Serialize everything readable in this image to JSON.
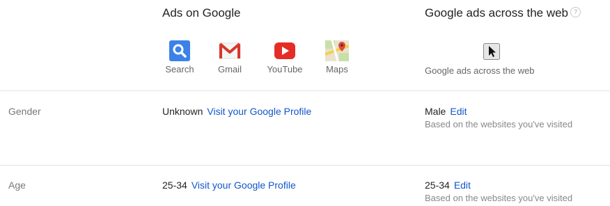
{
  "header": {
    "google_col_title": "Ads on Google",
    "web_col_title": "Google ads across the web",
    "help_icon": "question-mark-icon",
    "help_glyph": "?"
  },
  "products": [
    {
      "label": "Search",
      "icon": "search-icon",
      "color": "#4285f4"
    },
    {
      "label": "Gmail",
      "icon": "gmail-icon",
      "color": "#db4437"
    },
    {
      "label": "YouTube",
      "icon": "youtube-icon",
      "color": "#e62117"
    },
    {
      "label": "Maps",
      "icon": "maps-icon",
      "color": "#34a853"
    }
  ],
  "web_product": {
    "label": "Google ads across the web",
    "icon": "cursor-icon"
  },
  "rows": [
    {
      "label": "Gender",
      "google_value": "Unknown",
      "google_link": "Visit your Google Profile",
      "web_value": "Male",
      "web_link": "Edit",
      "web_note": "Based on the websites you've visited"
    },
    {
      "label": "Age",
      "google_value": "25-34",
      "google_link": "Visit your Google Profile",
      "web_value": "25-34",
      "web_link": "Edit",
      "web_note": "Based on the websites you've visited"
    }
  ],
  "colors": {
    "link": "#1155cc",
    "muted": "#888888",
    "divider": "#e3e3e3"
  }
}
